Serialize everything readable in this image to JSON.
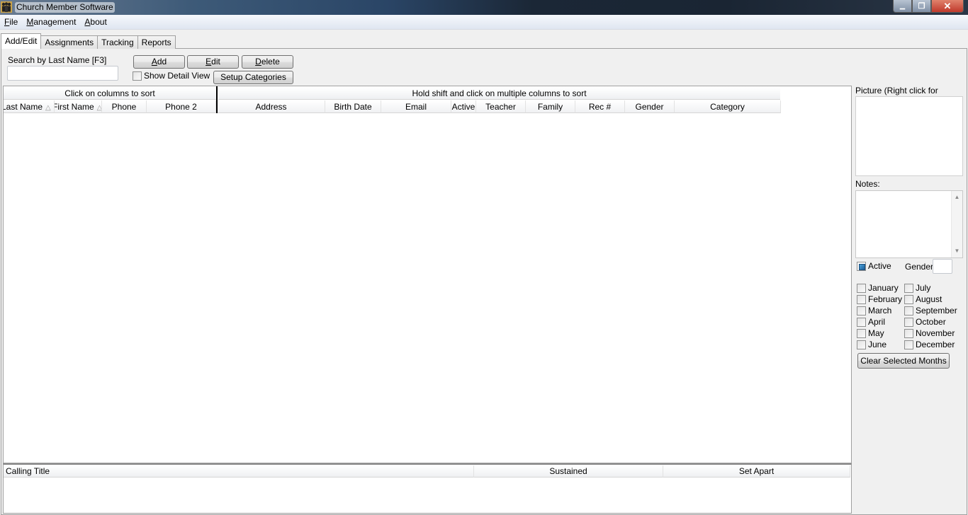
{
  "window": {
    "title": "Church Member Software",
    "controls": {
      "minimize": "▁",
      "maximize": "❐",
      "close": "✕"
    }
  },
  "menu": [
    {
      "label": "File",
      "mnemonic": "F",
      "rest": "ile"
    },
    {
      "label": "Management",
      "mnemonic": "M",
      "rest": "anagement"
    },
    {
      "label": "About",
      "mnemonic": "A",
      "rest": "bout"
    }
  ],
  "tabs": [
    {
      "label": "Add/Edit",
      "active": true
    },
    {
      "label": "Assignments",
      "active": false
    },
    {
      "label": "Tracking",
      "active": false
    },
    {
      "label": "Reports",
      "active": false
    }
  ],
  "search": {
    "label": "Search by Last Name [F3]",
    "value": "",
    "placeholder": ""
  },
  "toolbar": {
    "add": {
      "mnemonic": "A",
      "rest": "dd"
    },
    "edit": {
      "mnemonic": "E",
      "rest": "dit"
    },
    "delete": {
      "mnemonic": "D",
      "rest": "elete"
    },
    "setup_categories": "Setup Categories",
    "show_detail_view": {
      "label": "Show Detail View",
      "checked": false
    }
  },
  "grid": {
    "frozen_band_label": "Click on columns to sort",
    "scroll_band_label": "Hold shift and click on multiple columns to sort",
    "frozen_columns": [
      {
        "label": "Last Name",
        "sort": "△"
      },
      {
        "label": "First Name",
        "sort": "△"
      },
      {
        "label": "Phone",
        "sort": ""
      },
      {
        "label": "Phone 2",
        "sort": ""
      }
    ],
    "columns": [
      "Address",
      "Birth Date",
      "Email",
      "Active",
      "Teacher",
      "Family",
      "Rec #",
      "Gender",
      "Category"
    ],
    "rows": []
  },
  "details": {
    "picture_label": "Picture (Right click for options)",
    "notes_label": "Notes:",
    "notes_value": "",
    "active": {
      "label": "Active",
      "checked": true
    },
    "gender": {
      "label": "Gender",
      "value": ""
    },
    "months": [
      {
        "label": "January",
        "checked": false
      },
      {
        "label": "February",
        "checked": false
      },
      {
        "label": "March",
        "checked": false
      },
      {
        "label": "April",
        "checked": false
      },
      {
        "label": "May",
        "checked": false
      },
      {
        "label": "June",
        "checked": false
      },
      {
        "label": "July",
        "checked": false
      },
      {
        "label": "August",
        "checked": false
      },
      {
        "label": "September",
        "checked": false
      },
      {
        "label": "October",
        "checked": false
      },
      {
        "label": "November",
        "checked": false
      },
      {
        "label": "December",
        "checked": false
      }
    ],
    "clear_months_button": "Clear Selected Months"
  },
  "callings": {
    "columns": [
      "Calling Title",
      "Sustained",
      "Set Apart"
    ],
    "rows": []
  }
}
